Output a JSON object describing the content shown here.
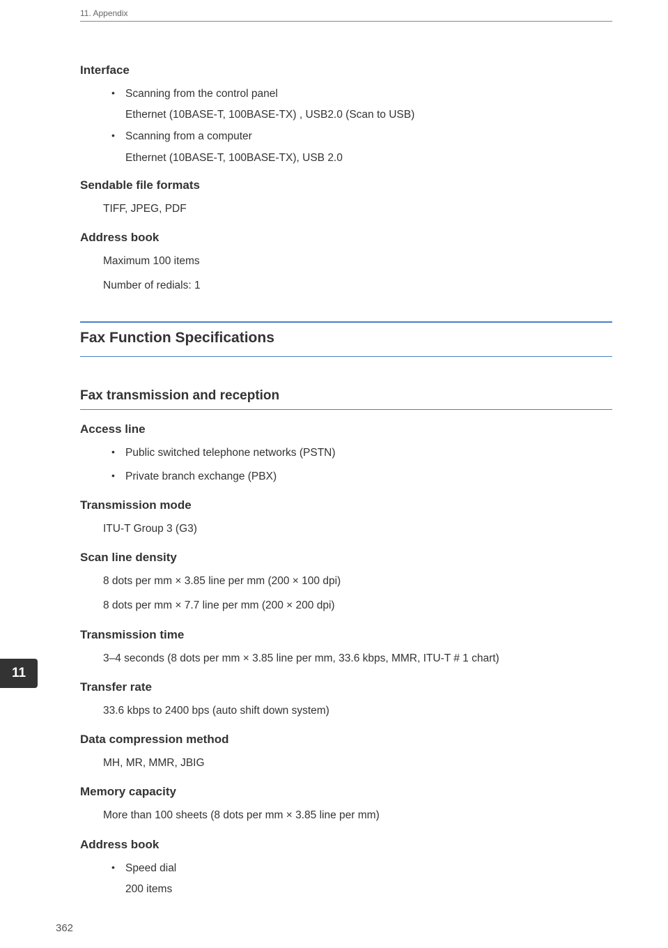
{
  "header": "11. Appendix",
  "chapterTab": "11",
  "pageNumber": "362",
  "sections": {
    "interface": {
      "heading": "Interface",
      "items": [
        {
          "title": "Scanning from the control panel",
          "detail": "Ethernet (10BASE-T, 100BASE-TX) , USB2.0 (Scan to USB)"
        },
        {
          "title": "Scanning from a computer",
          "detail": "Ethernet (10BASE-T, 100BASE-TX), USB 2.0"
        }
      ]
    },
    "sendableFormats": {
      "heading": "Sendable file formats",
      "value": "TIFF, JPEG, PDF"
    },
    "addressBook1": {
      "heading": "Address book",
      "line1": "Maximum 100 items",
      "line2": "Number of redials: 1"
    },
    "faxSpecs": {
      "heading": "Fax Function Specifications"
    },
    "faxTransReception": {
      "heading": "Fax transmission and reception"
    },
    "accessLine": {
      "heading": "Access line",
      "items": [
        "Public switched telephone networks (PSTN)",
        "Private branch exchange (PBX)"
      ]
    },
    "transmissionMode": {
      "heading": "Transmission mode",
      "value": "ITU-T Group 3 (G3)"
    },
    "scanLineDensity": {
      "heading": "Scan line density",
      "line1": "8 dots per mm × 3.85 line per mm (200 × 100 dpi)",
      "line2": "8 dots per mm × 7.7 line per mm (200 × 200 dpi)"
    },
    "transmissionTime": {
      "heading": "Transmission time",
      "value": "3–4 seconds (8 dots per mm × 3.85 line per mm, 33.6 kbps, MMR, ITU-T # 1 chart)"
    },
    "transferRate": {
      "heading": "Transfer rate",
      "value": "33.6 kbps to 2400 bps (auto shift down system)"
    },
    "dataCompression": {
      "heading": "Data compression method",
      "value": "MH, MR, MMR, JBIG"
    },
    "memoryCapacity": {
      "heading": "Memory capacity",
      "value": "More than 100 sheets (8 dots per mm × 3.85 line per mm)"
    },
    "addressBook2": {
      "heading": "Address book",
      "item1": "Speed dial",
      "item1Detail": "200 items"
    }
  }
}
